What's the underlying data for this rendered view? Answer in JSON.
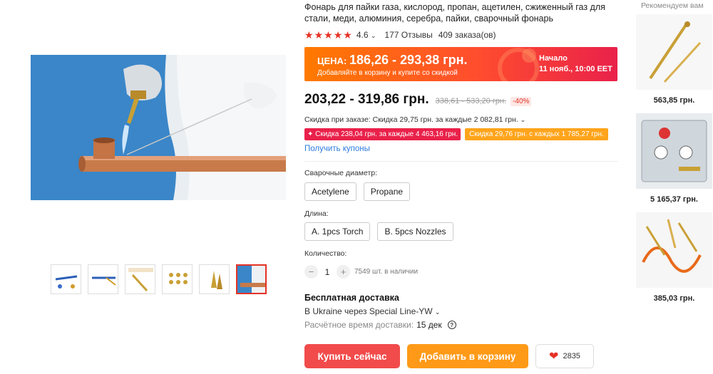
{
  "product": {
    "title": "Фонарь для пайки газа, кислород, пропан, ацетилен, сжиженный газ для стали, меди, алюминия, серебра, пайки, сварочный фонарь",
    "rating": "4.6",
    "reviews": "177 Отзывы",
    "orders": "409 заказа(ов)",
    "stars": 5
  },
  "promo": {
    "label": "ЦЕНА:",
    "range": "186,26 - 293,38 грн.",
    "subtitle": "Добавляйте в корзину и купите со скидкой",
    "start_label": "Начало",
    "start_date": "11 нояб., 10:00 EET"
  },
  "price": {
    "current": "203,22 - 319,86 грн.",
    "old": "338,61 - 533,20 грн.",
    "discount": "-40%"
  },
  "discounts": {
    "order": "Скидка при заказе: Скидка 29,75 грн. за каждые 2 082,81 грн.",
    "coupon_red": "✦ Скидка 238,04 грн. за каждые 4 463,16 грн.",
    "coupon_orange": "Скидка 29,76 грн. с каждых 1 785,27 грн.",
    "get_coupons": "Получить купоны"
  },
  "options": {
    "diameter_label": "Сварочные диаметр:",
    "diameter": [
      "Acetylene",
      "Propane"
    ],
    "length_label": "Длина:",
    "length": [
      "A. 1pcs Torch",
      "B. 5pcs Nozzles"
    ]
  },
  "quantity": {
    "label": "Количество:",
    "value": "1",
    "minus": "−",
    "plus": "+",
    "stock": "7549 шт. в наличии"
  },
  "shipping": {
    "title": "Бесплатная доставка",
    "via": "В Ukraine через Special Line-YW",
    "time_label": "Расчётное время доставки:",
    "time_value": "15 дек"
  },
  "actions": {
    "buy": "Купить сейчас",
    "cart": "Добавить в корзину",
    "wishlist_count": "2835"
  },
  "recommended": {
    "title": "Рекомендуем вам",
    "items": [
      {
        "price": "563,85 грн."
      },
      {
        "price": "5 165,37 грн."
      },
      {
        "price": "385,03 грн."
      }
    ]
  },
  "colors": {
    "accent_red": "#e43225",
    "buy": "#f24b4b",
    "cart": "#ff9a18",
    "link": "#2e7be0"
  }
}
